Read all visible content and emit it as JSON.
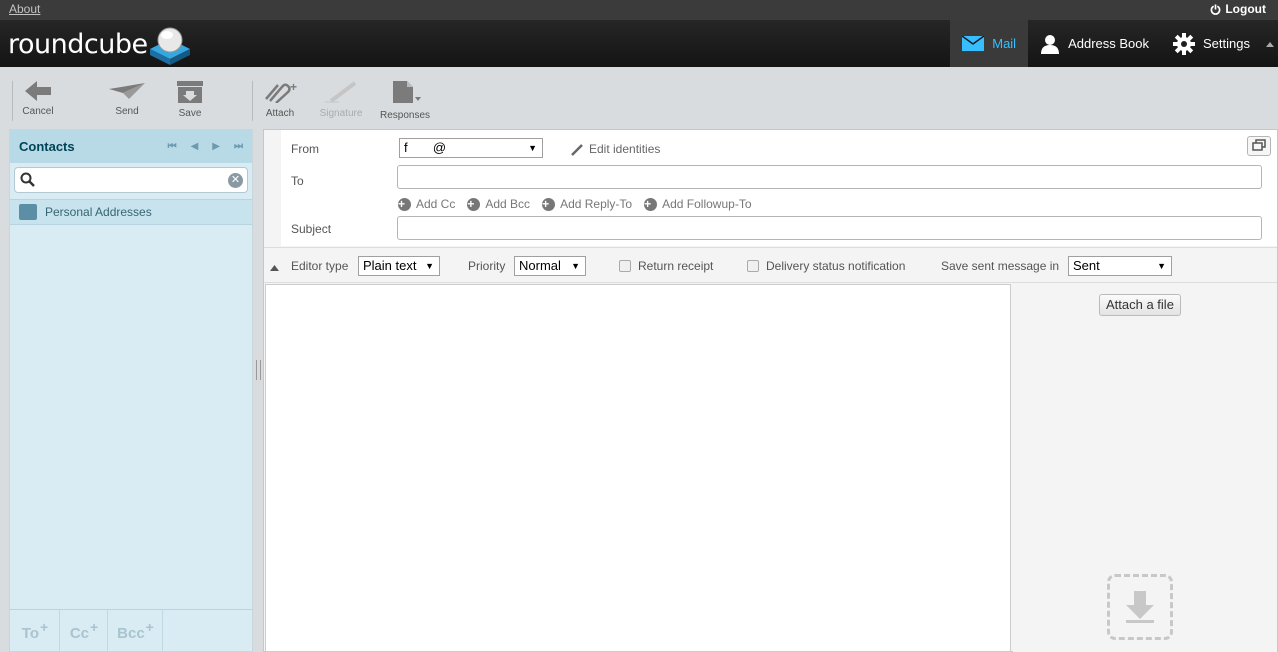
{
  "topline": {
    "about": "About",
    "logout": "Logout"
  },
  "header": {
    "logo": "roundcube",
    "tasks": [
      {
        "label": "Mail",
        "icon": "mail-icon",
        "active": true
      },
      {
        "label": "Address Book",
        "icon": "person-icon",
        "active": false
      },
      {
        "label": "Settings",
        "icon": "gear-icon",
        "active": false
      }
    ]
  },
  "toolbar": {
    "cancel": "Cancel",
    "send": "Send",
    "save": "Save",
    "attach": "Attach",
    "signature": "Signature",
    "responses": "Responses"
  },
  "contacts": {
    "title": "Contacts",
    "search_placeholder": "",
    "addressbooks": [
      "Personal Addresses"
    ],
    "footer": [
      "To",
      "Cc",
      "Bcc"
    ]
  },
  "compose": {
    "from_label": "From",
    "from_value": "f       @       ",
    "edit_identities": "Edit identities",
    "to_label": "To",
    "to_value": "",
    "add_cc": "Add Cc",
    "add_bcc": "Add Bcc",
    "add_reply_to": "Add Reply-To",
    "add_followup_to": "Add Followup-To",
    "subject_label": "Subject",
    "subject_value": ""
  },
  "options": {
    "editor_type_label": "Editor type",
    "editor_type_value": "Plain text",
    "priority_label": "Priority",
    "priority_value": "Normal",
    "return_receipt": "Return receipt",
    "return_receipt_checked": false,
    "dsn": "Delivery status notification",
    "dsn_checked": false,
    "save_sent_label": "Save sent message in",
    "save_sent_value": "Sent"
  },
  "attachments": {
    "attach_button": "Attach a file"
  },
  "colors": {
    "accent": "#37beff",
    "panel": "#d9ecf4",
    "header": "#1c1c1c"
  }
}
